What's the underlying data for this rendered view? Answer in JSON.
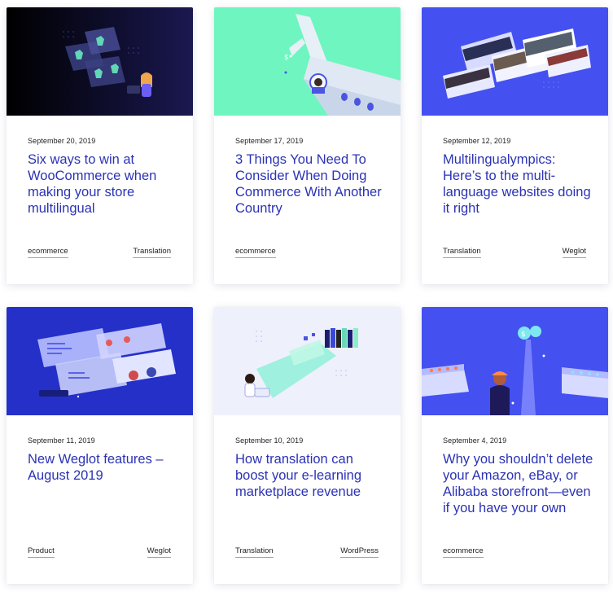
{
  "posts": [
    {
      "date": "September 20, 2019",
      "title": "Six ways to win at WooCommerce when making your store multilingual",
      "tags": [
        "ecommerce",
        "Translation"
      ],
      "image": "woocommerce-illustration"
    },
    {
      "date": "September 17, 2019",
      "title": "3 Things You Need To Consider When Doing Commerce With Another Country",
      "tags": [
        "ecommerce"
      ],
      "image": "airplane-illustration"
    },
    {
      "date": "September 12, 2019",
      "title": "Multilingualympics: Here’s to the multi-language websites doing it right",
      "tags": [
        "Translation",
        "Weglot"
      ],
      "image": "websites-illustration"
    },
    {
      "date": "September 11, 2019",
      "title": "New Weglot features – August 2019",
      "tags": [
        "Product",
        "Weglot"
      ],
      "image": "features-illustration"
    },
    {
      "date": "September 10, 2019",
      "title": "How translation can boost your e-learning marketplace revenue",
      "tags": [
        "Translation",
        "WordPress"
      ],
      "image": "elearning-illustration"
    },
    {
      "date": "September 4, 2019",
      "title": "Why you shouldn’t delete your Amazon, eBay, or Alibaba storefront—even if you have your own",
      "tags": [
        "ecommerce"
      ],
      "image": "storefront-illustration"
    }
  ],
  "colors": {
    "title": "#2b33b5",
    "card_bg": "#ffffff",
    "thumb_dark": "#141433",
    "thumb_mint": "#6ff5c0",
    "thumb_blue": "#4450f0",
    "thumb_navy": "#2430c8",
    "thumb_light": "#eef0fb"
  }
}
